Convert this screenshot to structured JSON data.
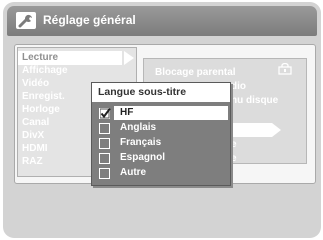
{
  "header": {
    "title": "Réglage général",
    "icon": "wrench-icon"
  },
  "left_menu": {
    "items": [
      {
        "label": "Lecture",
        "selected": true
      },
      {
        "label": "Affichage"
      },
      {
        "label": "Vidéo"
      },
      {
        "label": "Enregist."
      },
      {
        "label": "Horloge"
      },
      {
        "label": "Canal"
      },
      {
        "label": "DivX"
      },
      {
        "label": "HDMI"
      },
      {
        "label": "RAZ"
      }
    ]
  },
  "right_menu": {
    "items": [
      {
        "label": "Blocage parental"
      },
      {
        "label": "dio"
      },
      {
        "label": "nu disque"
      },
      {
        "label": "tre"
      },
      {
        "label": "e"
      },
      {
        "label": "e"
      }
    ],
    "lock_icon": "lock-icon"
  },
  "popup": {
    "title": "Langue sous-titre",
    "options": [
      {
        "label": "HF",
        "checked": true
      },
      {
        "label": "Anglais",
        "checked": false
      },
      {
        "label": "Français",
        "checked": false
      },
      {
        "label": "Espagnol",
        "checked": false
      },
      {
        "label": "Autre",
        "checked": false
      }
    ]
  },
  "colors": {
    "background": "#d3d3d3",
    "title_bar": "#8a8a8a",
    "popup_list": "#7e7e7e",
    "highlight": "#ffffff"
  }
}
